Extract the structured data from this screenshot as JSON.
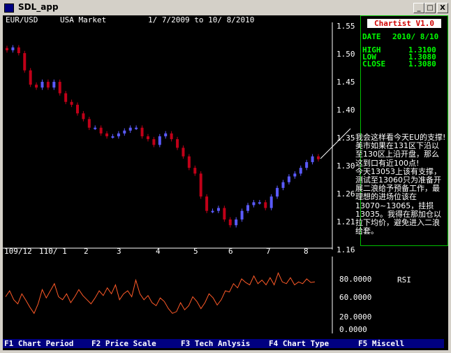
{
  "window": {
    "title": "SDL_app",
    "buttons": {
      "minimize": "_",
      "maximize": "□",
      "close": "X"
    }
  },
  "header": {
    "symbol": "EUR/USD",
    "market": "USA Market",
    "range": "1/ 7/2009 to 10/ 8/2010"
  },
  "price_axis": [
    "1.55",
    "1.50",
    "1.45",
    "1.40",
    "1.35",
    "1.30",
    "1.26",
    "1.21",
    "1.16"
  ],
  "date_axis": [
    "109/12",
    "110/ 1",
    "2",
    "3",
    "4",
    "5",
    "6",
    "7",
    "8"
  ],
  "rsi_axis": [
    "80.0000",
    "60.0000",
    "20.0000",
    "0.0000"
  ],
  "rsi_title": "RSI",
  "info": {
    "badge": "Chartist V1.0",
    "date_label": "DATE",
    "date_value": "2010/ 8/10",
    "high_label": "HIGH",
    "high_value": "1.3100",
    "low_label": "LOW",
    "low_value": "1.3080",
    "close_label": "CLOSE",
    "close_value": "1.3080"
  },
  "annotation": "我会这样看今天EU的支撑!\n美市如果在131区下沿以至130区上沿开盘，那么这到口有近100点!\n今天13053上该有支撑，测试至13060只为准备开展二浪给予预备工作，最理想的进场位该在13070~13065，挂损13035。我得在那加仓以拉下均价，避免进入二浪给套。",
  "function_keys": [
    {
      "key": "F1",
      "label": "Chart Period"
    },
    {
      "key": "F2",
      "label": "Price Scale"
    },
    {
      "key": "F3",
      "label": "Tech Anlysis"
    },
    {
      "key": "F4",
      "label": "Chart Type"
    },
    {
      "key": "F5",
      "label": "Miscell"
    }
  ],
  "colors": {
    "up": "#5b5bff",
    "down": "#c00018",
    "rsi": "#ff5a28",
    "panel_border": "#00c000",
    "info_text": "#00ff00"
  },
  "chart_data": [
    {
      "type": "candlestick",
      "title": "EUR/USD",
      "ylim": [
        1.16,
        1.55
      ],
      "xlabel": "",
      "ylabel": "",
      "x_ticks": [
        "109/12",
        "110/ 1",
        "2",
        "3",
        "4",
        "5",
        "6",
        "7",
        "8"
      ],
      "series": [
        {
          "values": [
            1.505,
            1.51,
            1.5,
            1.47,
            1.445,
            1.44,
            1.45,
            1.44,
            1.45,
            1.43,
            1.415,
            1.41,
            1.395,
            1.385,
            1.37,
            1.37,
            1.36,
            1.355,
            1.355,
            1.36,
            1.365,
            1.37,
            1.37,
            1.355,
            1.35,
            1.34,
            1.355,
            1.36,
            1.35,
            1.335,
            1.32,
            1.3,
            1.29,
            1.25,
            1.225,
            1.225,
            1.23,
            1.21,
            1.2,
            1.21,
            1.225,
            1.235,
            1.24,
            1.24,
            1.23,
            1.25,
            1.265,
            1.275,
            1.285,
            1.29,
            1.3,
            1.31,
            1.32,
            1.315
          ]
        }
      ]
    },
    {
      "type": "line",
      "title": "RSI",
      "ylim": [
        0,
        100
      ],
      "y_ticks": [
        0,
        20,
        60,
        80
      ],
      "series": [
        {
          "values": [
            50,
            60,
            45,
            38,
            55,
            44,
            32,
            22,
            38,
            62,
            48,
            60,
            72,
            50,
            45,
            55,
            40,
            50,
            62,
            52,
            45,
            38,
            48,
            60,
            52,
            65,
            55,
            70,
            45,
            55,
            60,
            50,
            78,
            55,
            45,
            52,
            40,
            35,
            48,
            42,
            30,
            22,
            25,
            40,
            28,
            35,
            50,
            42,
            30,
            40,
            55,
            48,
            36,
            45,
            60,
            58,
            72,
            65,
            80,
            74,
            70,
            85,
            72,
            78,
            70,
            82,
            70,
            90,
            75,
            72,
            82,
            70,
            75,
            72,
            80,
            74,
            75
          ]
        }
      ]
    }
  ]
}
